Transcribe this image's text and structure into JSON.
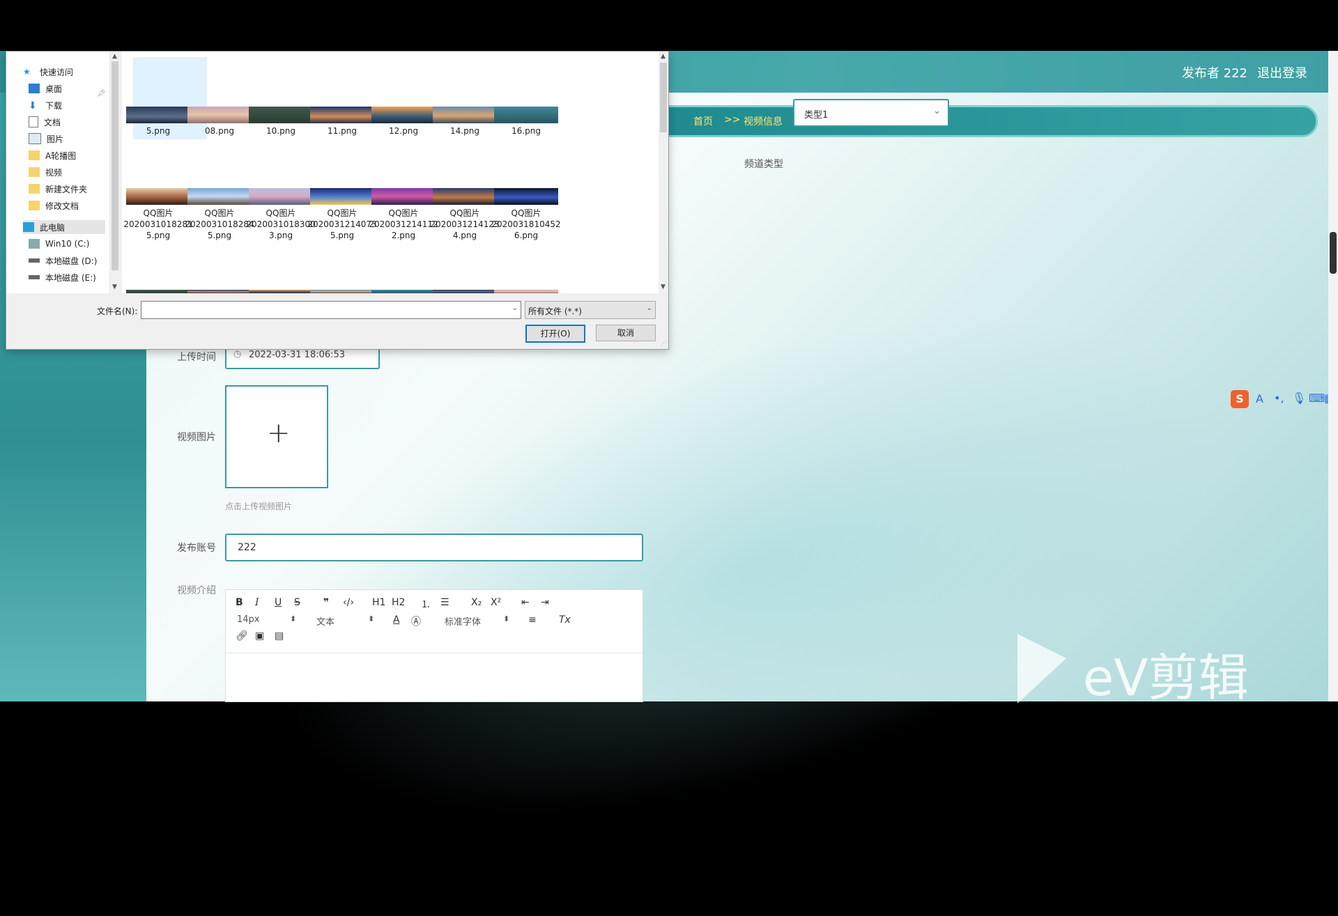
{
  "header": {
    "publisher": "发布者 222",
    "logout": "退出登录"
  },
  "breadcrumb": {
    "home": "首页",
    "sep": ">>",
    "current": "视频信息"
  },
  "form": {
    "channel_label": "频道类型",
    "channel_value": "类型1",
    "upload_time_label": "上传时间",
    "upload_time_value": "2022-03-31 18:06:53",
    "video_image_label": "视频图片",
    "upload_hint": "点击上传视频图片",
    "account_label": "发布账号",
    "account_value": "222",
    "intro_label": "视频介绍"
  },
  "editor_toolbar": {
    "size": "14px",
    "block": "文本",
    "font": "标准字体",
    "h1": "H1",
    "h2": "H2",
    "sub": "X₂",
    "sup": "X²"
  },
  "dialog": {
    "nav": [
      {
        "label": "快速访问",
        "icon": "star-icon"
      },
      {
        "label": "桌面",
        "icon": "desktop-icon"
      },
      {
        "label": "下载",
        "icon": "download-icon"
      },
      {
        "label": "文档",
        "icon": "document-icon"
      },
      {
        "label": "图片",
        "icon": "pictures-icon"
      },
      {
        "label": "A轮播图",
        "icon": "folder-icon"
      },
      {
        "label": "视频",
        "icon": "folder-icon"
      },
      {
        "label": "新建文件夹",
        "icon": "folder-icon"
      },
      {
        "label": "修改文档",
        "icon": "folder-icon"
      },
      {
        "label": "此电脑",
        "icon": "computer-icon"
      },
      {
        "label": "Win10 (C:)",
        "icon": "drive-icon"
      },
      {
        "label": "本地磁盘 (D:)",
        "icon": "drive-icon"
      },
      {
        "label": "本地磁盘 (E:)",
        "icon": "drive-icon"
      }
    ],
    "files_row1": [
      "5.png",
      "08.png",
      "10.png",
      "11.png",
      "12.png",
      "14.png",
      "16.png"
    ],
    "files_row2": [
      [
        "QQ图片",
        "2020031018281",
        "5.png"
      ],
      [
        "QQ图片",
        "2020031018284",
        "5.png"
      ],
      [
        "QQ图片",
        "2020031018300",
        "3.png"
      ],
      [
        "QQ图片",
        "2020031214073",
        "5.png"
      ],
      [
        "QQ图片",
        "2020031214112",
        "2.png"
      ],
      [
        "QQ图片",
        "2020031214123",
        "4.png"
      ],
      [
        "QQ图片",
        "2020031810452",
        "6.png"
      ]
    ],
    "filename_label": "文件名(N):",
    "filename_value": "",
    "filter": "所有文件 (*.*)",
    "open_button": "打开(O)",
    "cancel_button": "取消"
  },
  "watermark": "eV剪辑"
}
